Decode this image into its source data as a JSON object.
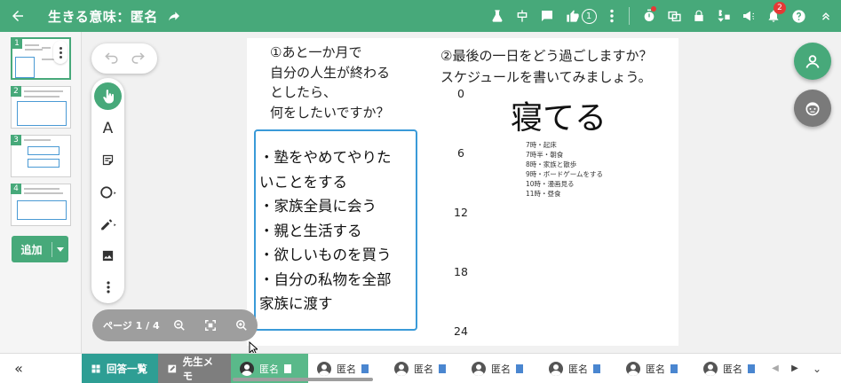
{
  "header": {
    "title": "生きる意味：匿名",
    "like_count": "1",
    "notification_count": "2",
    "icons": [
      "back-arrow-icon",
      "share-icon",
      "lab-icon",
      "layout-icon",
      "comment-icon",
      "thumb-up-icon",
      "more-vert-icon",
      "timer-icon",
      "view-toggle-icon",
      "lock-icon",
      "gallery-icon",
      "megaphone-icon",
      "bell-icon",
      "help-icon",
      "collapse-up-icon"
    ]
  },
  "sidebar": {
    "pages": [
      {
        "num": "1"
      },
      {
        "num": "2"
      },
      {
        "num": "3"
      },
      {
        "num": "4"
      }
    ],
    "add_label": "追加"
  },
  "canvas": {
    "question1": [
      "①あと一か月で",
      "自分の人生が終わる",
      "としたら、",
      "何をしたいですか？"
    ],
    "question2": [
      "②最後の一日をどう過ごしますか？",
      "スケジュールを書いてみましょう。"
    ],
    "answer_lines": [
      "・塾をやめてやりた",
      "いことをする",
      "・家族全員に会う",
      "・親と生活する",
      "・欲しいものを買う",
      "・自分の私物を全部",
      "家族に渡す"
    ],
    "hours": [
      "0",
      "6",
      "12",
      "18",
      "24"
    ],
    "big_text": "寝てる",
    "schedule": [
      "7時・起床",
      "7時半・朝食",
      "8時・家族と散歩",
      "9時・ボードゲームをする",
      "10時・漫画見る",
      "11時・昼食"
    ]
  },
  "page_indicator": "ページ 1 / 4",
  "bottom": {
    "answers_tab": "回答一覧",
    "memo_tab": "先生メモ",
    "students": [
      "匿名",
      "匿名",
      "匿名",
      "匿名",
      "匿名",
      "匿名",
      "匿名"
    ]
  },
  "colors": {
    "primary": "#47a97a",
    "answer_border": "#3a9ad8",
    "teal_tab": "#2e9e94",
    "fab_gray": "#7a7a7a",
    "badge": "#e53935"
  }
}
